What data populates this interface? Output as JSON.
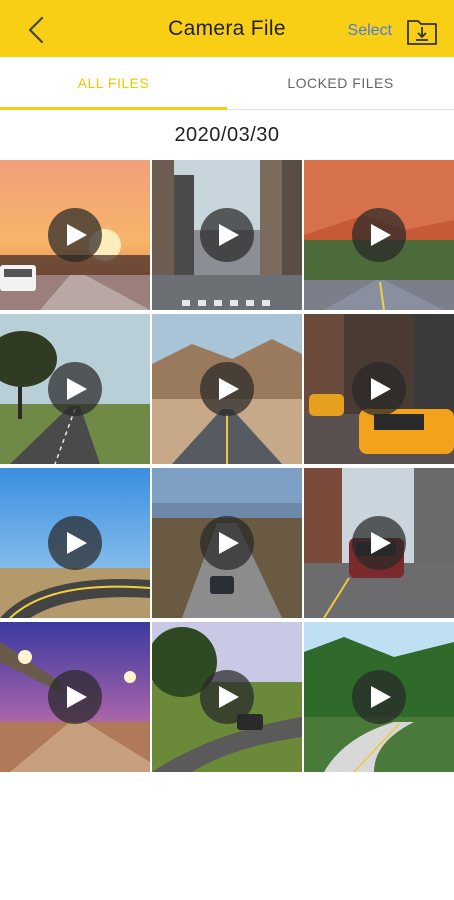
{
  "header": {
    "title": "Camera File",
    "select_label": "Select",
    "bg_color": "#f9cf15"
  },
  "tabs": [
    {
      "label": "ALL FILES",
      "active": true
    },
    {
      "label": "LOCKED FILES",
      "active": false
    }
  ],
  "date_group": "2020/03/30",
  "videos": [
    {
      "scene": "sunset-road"
    },
    {
      "scene": "city-crosswalk"
    },
    {
      "scene": "red-rock-road"
    },
    {
      "scene": "tree-field-road"
    },
    {
      "scene": "desert-road"
    },
    {
      "scene": "taxi-street"
    },
    {
      "scene": "curve-blue-sky"
    },
    {
      "scene": "hill-road-car"
    },
    {
      "scene": "city-street-car"
    },
    {
      "scene": "night-bridge-road"
    },
    {
      "scene": "green-curve-road"
    },
    {
      "scene": "mountain-road"
    }
  ],
  "icons": {
    "back": "chevron-left-icon",
    "download": "folder-download-icon",
    "play": "play-icon"
  }
}
